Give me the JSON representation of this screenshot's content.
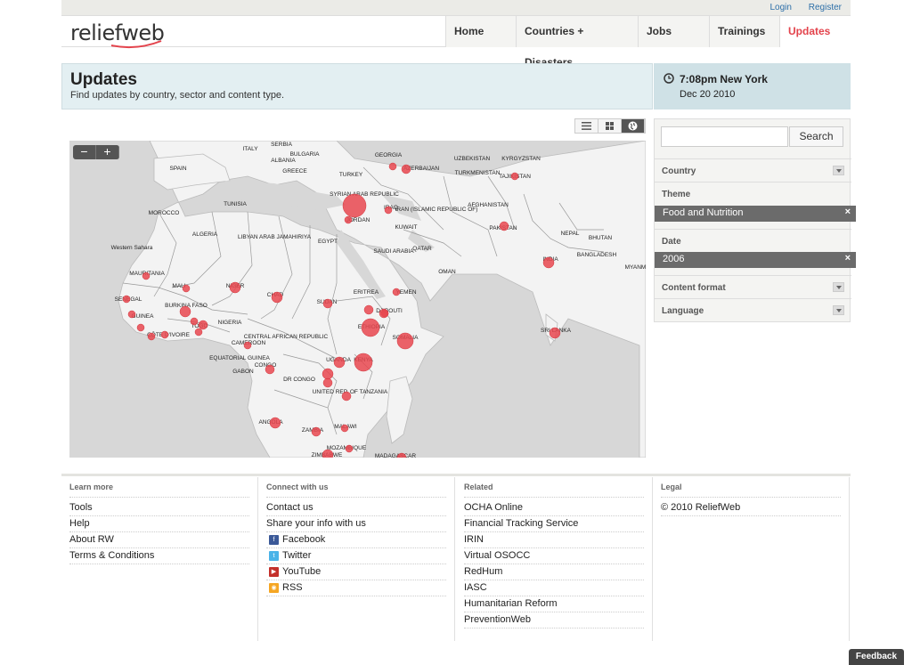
{
  "header": {
    "login": "Login",
    "register": "Register",
    "logo_text": "reliefweb",
    "nav": [
      "Home",
      "Countries + Disasters",
      "Jobs",
      "Trainings",
      "Updates"
    ]
  },
  "page": {
    "title": "Updates",
    "subtitle": "Find updates by country, sector and content type.",
    "time": "7:08pm New York",
    "date": "Dec 20 2010"
  },
  "sidebar": {
    "search_button": "Search",
    "country_label": "Country",
    "theme_label": "Theme",
    "theme_value": "Food and Nutrition",
    "date_label": "Date",
    "date_value": "2006",
    "content_format_label": "Content format",
    "language_label": "Language",
    "remove": "×"
  },
  "map": {
    "zoom_out": "−",
    "zoom_in": "+",
    "labels": [
      "SERBIA",
      "ITALY",
      "BULGARIA",
      "ALBANIA",
      "GEORGIA",
      "SPAIN",
      "GREECE",
      "AZERBAIJAN",
      "UZBEKISTAN",
      "KYRGYZSTAN",
      "TAJIKISTAN",
      "TURKMENISTAN",
      "TURKEY",
      "SYRIAN ARAB REPUBLIC",
      "IRAQ",
      "IRAN (ISLAMIC REPUBLIC OF)",
      "AFGHANISTAN",
      "TUNISIA",
      "MOROCCO",
      "JORDAN",
      "KUWAIT",
      "PAKISTAN",
      "ALGERIA",
      "LIBYAN ARAB JAMAHIRIYA",
      "EGYPT",
      "SAUDI ARABIA",
      "QATAR",
      "NEPAL",
      "BHUTAN",
      "BANGLADESH",
      "INDIA",
      "MYANMAR",
      "Western Sahara",
      "MAURITANIA",
      "MALI",
      "NIGER",
      "CHAD",
      "SUDAN",
      "ERITREA",
      "YEMEN",
      "OMAN",
      "SENEGAL",
      "BURKINA FASO",
      "GUINEA",
      "NIGERIA",
      "DJIBOUTI",
      "ETHIOPIA",
      "SOMALIA",
      "CÔTE D'IVOIRE",
      "TOGO",
      "CAMEROON",
      "CENTRAL AFRICAN REPUBLIC",
      "SRI LANKA",
      "EQUATORIAL GUINEA",
      "CONGO",
      "UGANDA",
      "KENYA",
      "GABON",
      "DR CONGO",
      "UNITED REP. OF TANZANIA",
      "ANGOLA",
      "ZAMBIA",
      "MALAWI",
      "MOZAMBIQUE",
      "ZIMBABWE",
      "MADAGASCAR"
    ]
  },
  "footer": {
    "learn_more": {
      "title": "Learn more",
      "links": [
        "Tools",
        "Help",
        "About RW",
        "Terms & Conditions"
      ]
    },
    "connect": {
      "title": "Connect with us",
      "links": [
        "Contact us",
        "Share your info with us"
      ],
      "social": [
        "Facebook",
        "Twitter",
        "YouTube",
        "RSS"
      ]
    },
    "related": {
      "title": "Related",
      "links": [
        "OCHA Online",
        "Financial Tracking Service",
        "IRIN",
        "Virtual OSOCC",
        "RedHum",
        "IASC",
        "Humanitarian Reform",
        "PreventionWeb"
      ]
    },
    "legal": {
      "title": "Legal",
      "links": [
        "© 2010 ReliefWeb"
      ]
    }
  },
  "feedback": "Feedback",
  "colors": {
    "accent": "#e3434c",
    "banner": "#e3eff2",
    "marker": "#e8474f"
  }
}
